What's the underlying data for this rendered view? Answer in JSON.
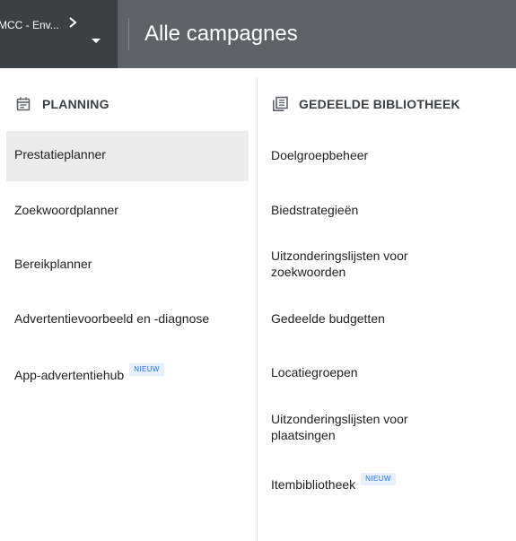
{
  "header": {
    "account_name": "MCC - Env...",
    "page_title": "Alle campagnes"
  },
  "planning": {
    "heading": "PLANNING",
    "icon": "calendar-icon",
    "items": [
      {
        "label": "Prestatieplanner",
        "active": true
      },
      {
        "label": "Zoekwoordplanner"
      },
      {
        "label": "Bereikplanner"
      },
      {
        "label": "Advertentievoorbeeld en -diagnose"
      },
      {
        "label": "App-advertentiehub",
        "badge": "NIEUW"
      }
    ]
  },
  "library": {
    "heading": "GEDEELDE BIBLIOTHEEK",
    "icon": "library-icon",
    "items": [
      {
        "label": "Doelgroepbeheer"
      },
      {
        "label": "Biedstrategieën"
      },
      {
        "label": "Uitzonderingslijsten voor zoekwoorden"
      },
      {
        "label": "Gedeelde budgetten"
      },
      {
        "label": "Locatiegroepen"
      },
      {
        "label": "Uitzonderingslijsten voor plaatsingen"
      },
      {
        "label": "Itembibliotheek",
        "badge": "NIEUW"
      }
    ]
  },
  "colors": {
    "topbar": "#5f6368",
    "account_bg": "#3c4043",
    "active_item_bg": "#ececec",
    "badge_text": "#1a73e8",
    "badge_bg": "#e8f0fe"
  }
}
